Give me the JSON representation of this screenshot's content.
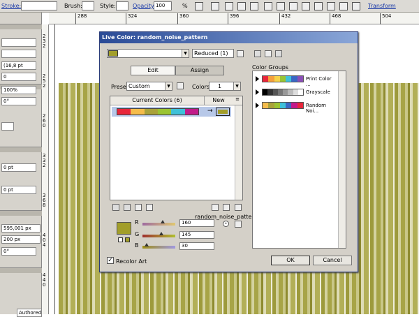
{
  "toolbar": {
    "stroke_label": "Stroke:",
    "brush_label": "Brush:",
    "style_label": "Style:",
    "opacity_label": "Opacity:",
    "opacity_value": "100",
    "percent": "%",
    "transform_link": "Transform"
  },
  "ruler": {
    "h_ticks": [
      "288",
      "324",
      "360",
      "396",
      "432",
      "468",
      "504"
    ],
    "v_ticks": [
      [
        "2",
        "3",
        "2"
      ],
      [
        "2",
        "5",
        "2"
      ],
      [
        "2",
        "6",
        "0"
      ],
      [
        "3",
        "3",
        "2"
      ],
      [
        "3",
        "6",
        "8"
      ],
      [
        "4",
        "0",
        "4"
      ],
      [
        "4",
        "4",
        "0"
      ]
    ]
  },
  "left_panel": {
    "f1": "(16,8 pt",
    "f2": "0",
    "f3": "100%",
    "f4": "0°",
    "f5": "0 pt",
    "f6": "0 pt",
    "f7": "595,001 px",
    "f8": "200 px",
    "f9": "0°",
    "f10": "Authored"
  },
  "dialog": {
    "title": "Live Color: random_noise_pattern",
    "reduced": "Reduced (1)",
    "tab_edit": "Edit",
    "tab_assign": "Assign",
    "preset_label": "Preset:",
    "preset_value": "Custom",
    "colors_label": "Colors:",
    "colors_value": "1",
    "current_colors_header": "Current Colors (6)",
    "new_header": "New",
    "current_colors": [
      "#e8263b",
      "#f5bc4b",
      "#a9a23a",
      "#9ac433",
      "#3fc1d9",
      "#c21b8a"
    ],
    "new_color": "#a29e2a",
    "pattern_name": "random_noise_pattern",
    "r_label": "R",
    "r_value": "160",
    "g_label": "G",
    "g_value": "145",
    "b_label": "B",
    "b_value": "30",
    "r_level": 0.627,
    "g_level": 0.569,
    "b_level": 0.118,
    "recolor_art": "Recolor Art",
    "recolor_checked": true,
    "ok": "OK",
    "cancel": "Cancel",
    "color_groups_title": "Color Groups",
    "color_groups": [
      {
        "name": "Print Color ...",
        "colors": [
          "#e8263b",
          "#f5a03c",
          "#f5d34a",
          "#9ac433",
          "#3fc1d9",
          "#3a67c4",
          "#8a4fb6"
        ]
      },
      {
        "name": "Grayscale",
        "colors": [
          "#000000",
          "#333333",
          "#555555",
          "#777777",
          "#999999",
          "#bbbbbb",
          "#dddddd",
          "#ffffff"
        ]
      },
      {
        "name": "Random Noi...",
        "colors": [
          "#f5bc4b",
          "#a9a23a",
          "#9ac433",
          "#3fc1d9",
          "#3a67c4",
          "#c21b8a",
          "#e8263b"
        ]
      }
    ]
  }
}
